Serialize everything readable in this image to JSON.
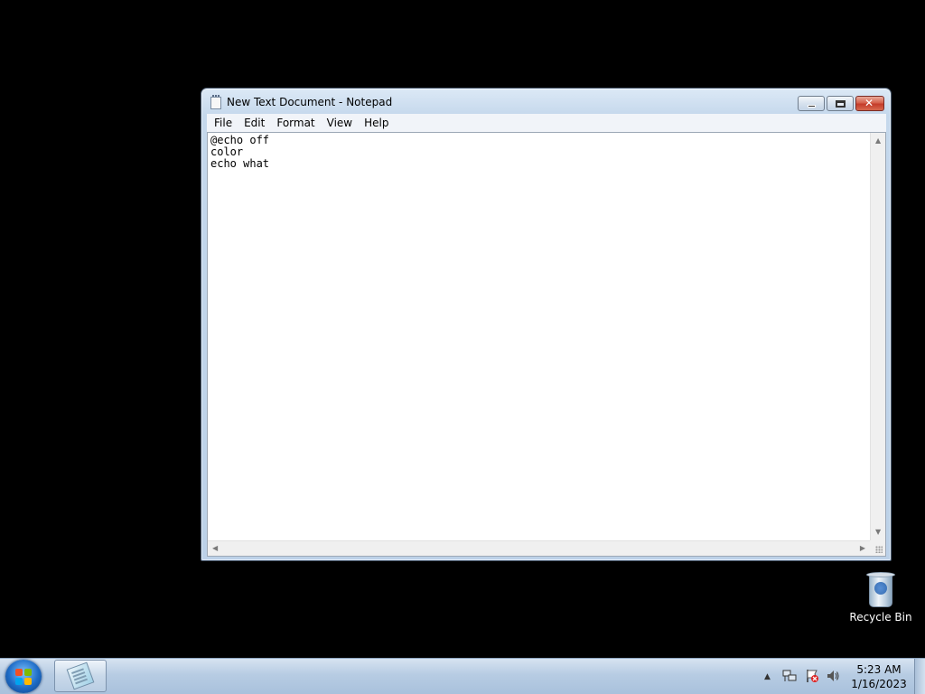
{
  "window": {
    "title": "New Text Document - Notepad",
    "menu": [
      "File",
      "Edit",
      "Format",
      "View",
      "Help"
    ],
    "content": "@echo off\ncolor\necho what"
  },
  "desktop": {
    "icons": [
      {
        "label": "Recycle Bin",
        "icon": "recycle-bin-icon"
      }
    ]
  },
  "taskbar": {
    "start_icon": "windows-logo-icon",
    "pinned": [
      {
        "icon": "notepad-icon"
      }
    ],
    "tray_icons": [
      "show-hidden-icons-arrow",
      "network-icon",
      "action-center-flag-icon",
      "volume-icon"
    ],
    "clock": {
      "time": "5:23 AM",
      "date": "1/16/2023"
    }
  },
  "colors": {
    "desktop": "#000000",
    "taskbar": "#b7cce3",
    "close_button": "#c43c2a"
  }
}
